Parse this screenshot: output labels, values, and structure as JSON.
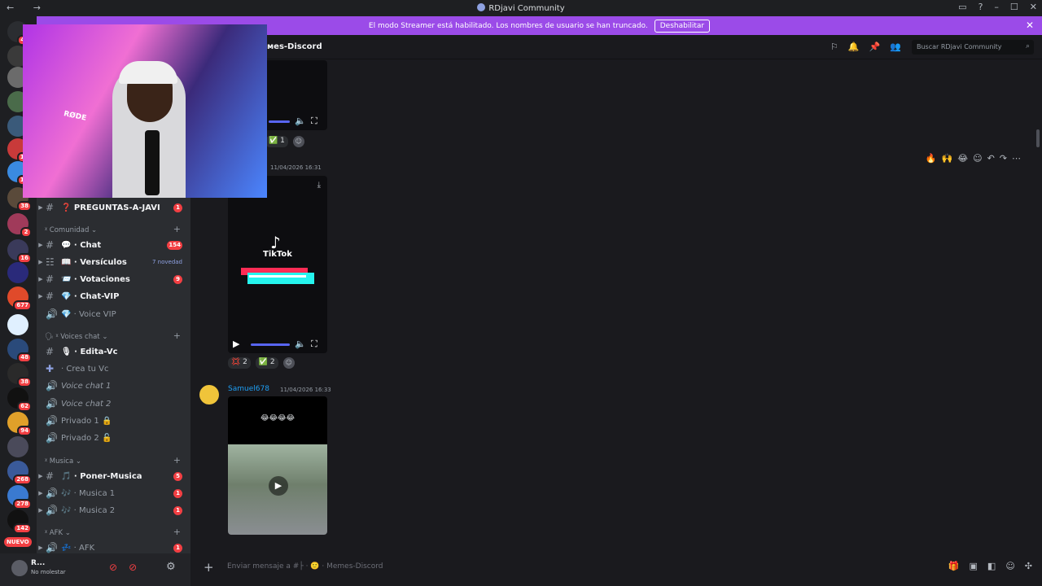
{
  "window": {
    "title": "RDjavi Community",
    "nav": "← →",
    "controls": [
      "▭",
      "?",
      "–",
      "☐",
      "✕"
    ]
  },
  "banner": {
    "text": "El modo Streamer está habilitado. Los nombres de usuario se han truncado.",
    "button": "Deshabilitar",
    "close": "✕"
  },
  "servers": [
    {
      "badge": "48",
      "color": "#2b2d31"
    },
    {
      "badge": "",
      "color": "#3a3a3a"
    },
    {
      "badge": "",
      "color": "#6b6b6b"
    },
    {
      "badge": "",
      "color": "#4a6b4a"
    },
    {
      "badge": "",
      "color": "#3a5a7a"
    },
    {
      "badge": "1K",
      "color": "#c83a3a"
    },
    {
      "badge": "1K",
      "color": "#3a8ae0"
    },
    {
      "badge": "38",
      "color": "#5a4a3a"
    },
    {
      "badge": "2",
      "color": "#a03a5a"
    },
    {
      "badge": "16",
      "color": "#3a3a5a"
    },
    {
      "badge": "",
      "color": "#2a2a7a"
    },
    {
      "badge": "677",
      "color": "#e04a2a"
    },
    {
      "badge": "",
      "color": "#e0f0ff"
    },
    {
      "badge": "48",
      "color": "#2a4a7a"
    },
    {
      "badge": "38",
      "color": "#2a2a2a"
    },
    {
      "badge": "62",
      "color": "#111111"
    },
    {
      "badge": "94",
      "color": "#e0a02a"
    },
    {
      "badge": "",
      "color": "#4a4a5a"
    },
    {
      "badge": "268",
      "color": "#3a5a9a"
    },
    {
      "badge": "278",
      "color": "#3a7ad0"
    },
    {
      "badge": "142",
      "color": "#111111"
    }
  ],
  "nuevo": "NUEVO",
  "sidebar": {
    "top_channel": {
      "label": "❓ PREGUNTAS-A-JAVI",
      "count": "1"
    },
    "categories": [
      {
        "name": "ᵡ Comunidad ⌄",
        "channels": [
          {
            "label": "💬 · Chat",
            "count": "154",
            "type": "text"
          },
          {
            "label": "📖 · Versículos",
            "new": "7 novedad",
            "type": "forum"
          },
          {
            "label": "📨 · Votaciones",
            "count": "9",
            "type": "text"
          },
          {
            "label": "💎 · Chat-VIP",
            "type": "text"
          },
          {
            "label": "💎 · Voice VIP",
            "type": "voice"
          }
        ]
      },
      {
        "name": "🗣 ᵡ Voices chat ⌄",
        "channels": [
          {
            "label": "🎙 · Edita-Vc",
            "type": "text"
          },
          {
            "label": "· Crea tu Vc",
            "type": "voice"
          },
          {
            "label": "Voice chat 1",
            "type": "voice"
          },
          {
            "label": "Voice chat 2",
            "type": "voice"
          },
          {
            "label": "Privado 1 🔒",
            "type": "voice"
          },
          {
            "label": "Privado 2 🔓",
            "type": "voice"
          }
        ]
      },
      {
        "name": "ᵡ Musica ⌄",
        "channels": [
          {
            "label": "🎵 · Poner-Musica",
            "count": "5",
            "type": "text"
          },
          {
            "label": "🎶 · Musica 1",
            "count": "1",
            "type": "voice"
          },
          {
            "label": "🎶 · Musica 2",
            "count": "1",
            "type": "voice"
          }
        ]
      },
      {
        "name": "ᵡ AFK ⌄",
        "channels": [
          {
            "label": "💤 · AFK",
            "count": "1",
            "type": "voice"
          }
        ]
      }
    ]
  },
  "user": {
    "name": "R...",
    "status": "No molestar"
  },
  "header": {
    "channel": "ᴍes-Discord",
    "search": "Buscar RDjavi Community"
  },
  "messages": [
    {
      "reactions": [
        {
          "emoji": "✅",
          "count": "1"
        }
      ]
    },
    {
      "timestamp": "11/04/2026 16:31",
      "video_label": "TikTok",
      "reactions": [
        {
          "emoji": "💢",
          "count": "2"
        },
        {
          "emoji": "✅",
          "count": "2"
        }
      ]
    },
    {
      "author": "Samuel678",
      "timestamp": "11/04/2026 16:33",
      "video_caption": "😂😂😂😂"
    }
  ],
  "message_actions": [
    "🔥",
    "🙌",
    "😂",
    "☺",
    "↶",
    "↷",
    "⋯"
  ],
  "composer": {
    "placeholder": "Enviar mensaje a #├ · 🙂 · Memes-Discord"
  }
}
